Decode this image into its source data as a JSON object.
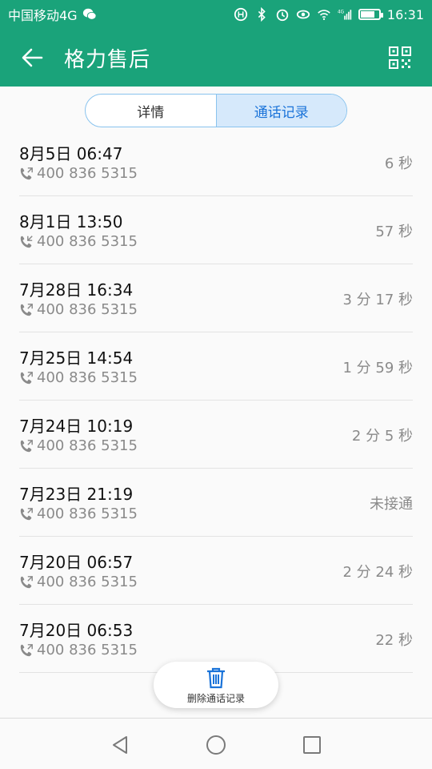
{
  "statusbar": {
    "carrier": "中国移动4G",
    "time": "16:31",
    "net_label": "4G"
  },
  "header": {
    "title": "格力售后"
  },
  "tabs": [
    {
      "label": "详情",
      "active": false
    },
    {
      "label": "通话记录",
      "active": true
    }
  ],
  "calls": [
    {
      "date": "8月5日 06:47",
      "number": "400 836 5315",
      "duration": "6 秒",
      "direction": "outgoing"
    },
    {
      "date": "8月1日 13:50",
      "number": "400 836 5315",
      "duration": "57 秒",
      "direction": "incoming"
    },
    {
      "date": "7月28日 16:34",
      "number": "400 836 5315",
      "duration": "3 分 17 秒",
      "direction": "outgoing"
    },
    {
      "date": "7月25日 14:54",
      "number": "400 836 5315",
      "duration": "1 分 59 秒",
      "direction": "outgoing"
    },
    {
      "date": "7月24日 10:19",
      "number": "400 836 5315",
      "duration": "2 分 5 秒",
      "direction": "outgoing"
    },
    {
      "date": "7月23日 21:19",
      "number": "400 836 5315",
      "duration": "未接通",
      "direction": "outgoing"
    },
    {
      "date": "7月20日 06:57",
      "number": "400 836 5315",
      "duration": "2 分 24 秒",
      "direction": "outgoing"
    },
    {
      "date": "7月20日 06:53",
      "number": "400 836 5315",
      "duration": "22 秒",
      "direction": "outgoing"
    }
  ],
  "delete_button": {
    "label": "删除通话记录"
  },
  "colors": {
    "header": "#1aa37a",
    "tab_active_bg": "#d6e9fb",
    "tab_active_text": "#1a73d9",
    "delete_icon": "#1a73d9"
  }
}
